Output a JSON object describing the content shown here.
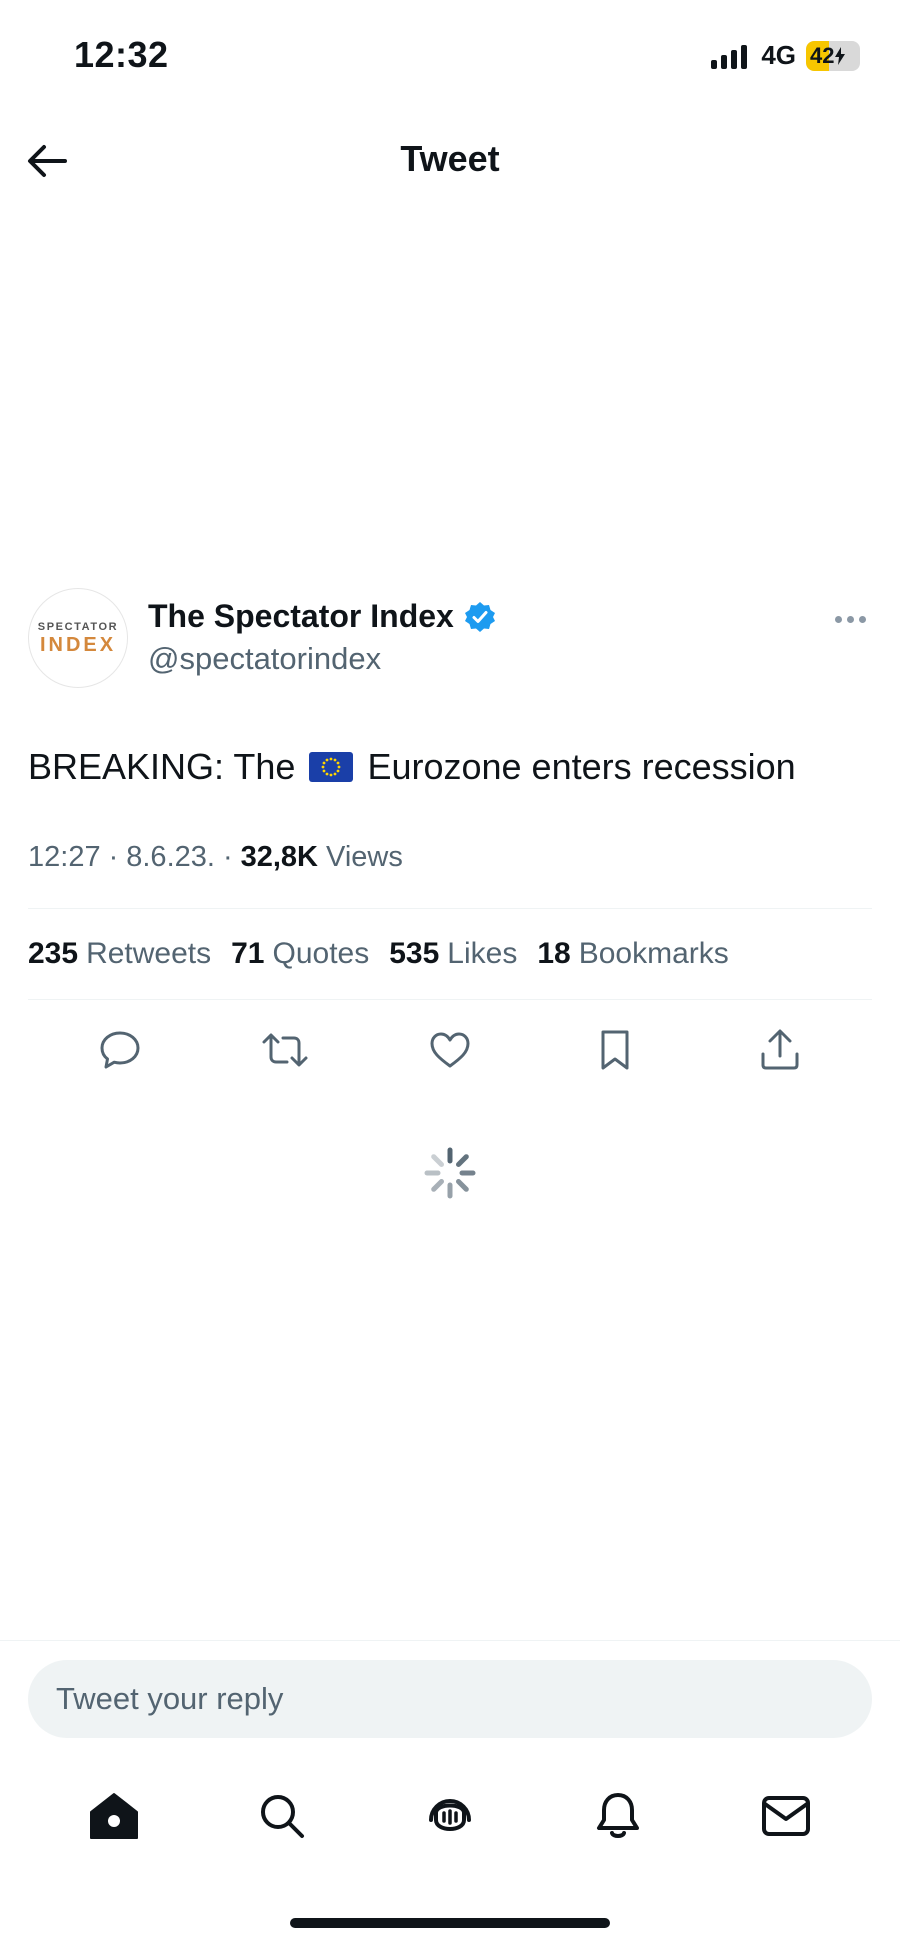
{
  "status_bar": {
    "time": "12:32",
    "network": "4G",
    "battery": "42",
    "battery_level": 0.42,
    "battery_color": "#f7c600"
  },
  "header": {
    "title": "Tweet"
  },
  "tweet": {
    "avatar_text_top": "SPECTATOR",
    "avatar_text_bottom": "INDEX",
    "author_name": "The Spectator Index",
    "author_handle": "@spectatorindex",
    "verified": true,
    "verified_color": "#1d9bf0",
    "text_before_flag": "BREAKING: The",
    "flag_icon": "eu-flag-icon",
    "text_after_flag": "Eurozone enters recession",
    "time": "12:27",
    "date": "8.6.23.",
    "views_count": "32,8K",
    "views_label": "Views"
  },
  "stats": [
    {
      "count": "235",
      "label": "Retweets"
    },
    {
      "count": "71",
      "label": "Quotes"
    },
    {
      "count": "535",
      "label": "Likes"
    },
    {
      "count": "18",
      "label": "Bookmarks"
    }
  ],
  "actions": [
    "reply-icon",
    "retweet-icon",
    "like-icon",
    "bookmark-icon",
    "share-icon"
  ],
  "reply": {
    "placeholder": "Tweet your reply"
  },
  "bottom_nav": [
    "home-icon",
    "search-icon",
    "spaces-icon",
    "notifications-icon",
    "messages-icon"
  ]
}
